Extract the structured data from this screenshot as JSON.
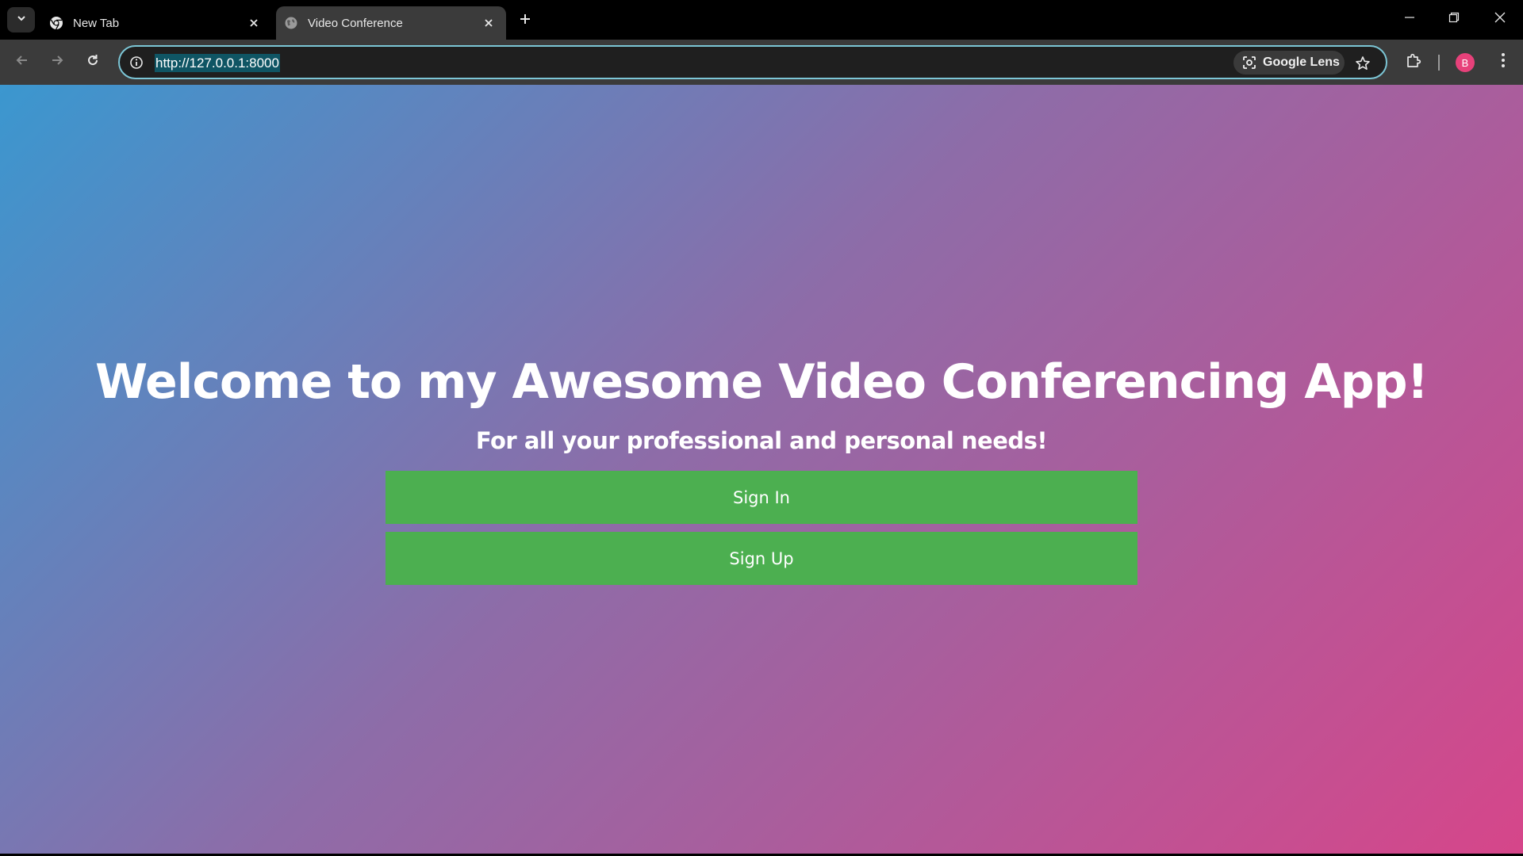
{
  "browser": {
    "tabs": [
      {
        "title": "New Tab",
        "icon": "chrome-icon",
        "active": false
      },
      {
        "title": "Video Conference",
        "icon": "globe-icon",
        "active": true
      }
    ],
    "url": "http://127.0.0.1:8000",
    "google_lens_label": "Google Lens",
    "profile_initial": "B",
    "colors": {
      "tab_strip": "#000000",
      "toolbar": "#3b3b3b",
      "omnibox_border": "#7cc6d6",
      "url_highlight": "#0f5564",
      "avatar": "#e7417a"
    }
  },
  "page": {
    "title": "Welcome to my Awesome Video Conferencing App!",
    "subtitle": "For all your professional and personal needs!",
    "sign_in_label": "Sign In",
    "sign_up_label": "Sign Up",
    "colors": {
      "button": "#4caf50",
      "gradient_start": "#3b97cf",
      "gradient_mid": "#8e6ca8",
      "gradient_end": "#d6468a"
    }
  }
}
